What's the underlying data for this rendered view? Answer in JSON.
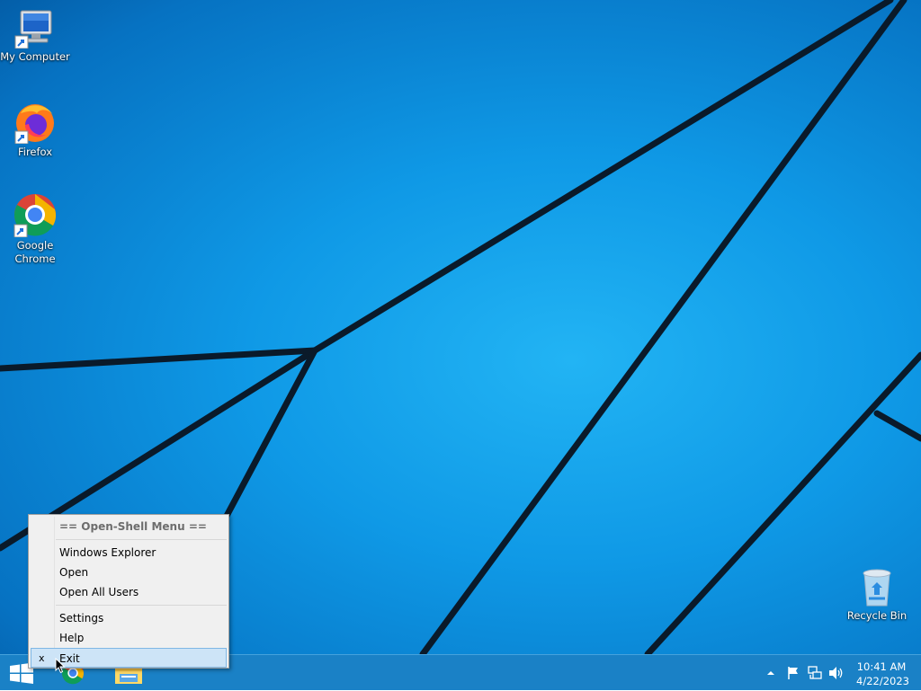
{
  "desktop": {
    "icons": [
      {
        "label": "My Computer",
        "icon": "computer-icon"
      },
      {
        "label": "Firefox",
        "icon": "firefox-icon"
      },
      {
        "label": "Google Chrome",
        "icon": "chrome-icon"
      },
      {
        "label": "Recycle Bin",
        "icon": "recycle-bin-icon"
      }
    ]
  },
  "context_menu": {
    "title": "== Open-Shell Menu ==",
    "items": [
      {
        "label": "Windows Explorer"
      },
      {
        "label": "Open"
      },
      {
        "label": "Open All Users"
      },
      {
        "label": "Settings"
      },
      {
        "label": "Help"
      },
      {
        "label": "Exit",
        "check": "x",
        "selected": true
      }
    ]
  },
  "taskbar": {
    "pinned": [
      {
        "icon": "windows-start-icon"
      },
      {
        "icon": "chrome-icon"
      },
      {
        "icon": "file-explorer-icon"
      }
    ],
    "tray_icons": [
      "chevron-up-icon",
      "flag-icon",
      "network-icon",
      "speaker-icon"
    ],
    "clock": {
      "time": "10:41 AM",
      "date": "4/22/2023"
    }
  },
  "colors": {
    "taskbar": "#1a81c6",
    "desktop_blue": "#0f99e6",
    "menu_bg": "#f0f0f0",
    "menu_highlight": "#cde4f7"
  }
}
